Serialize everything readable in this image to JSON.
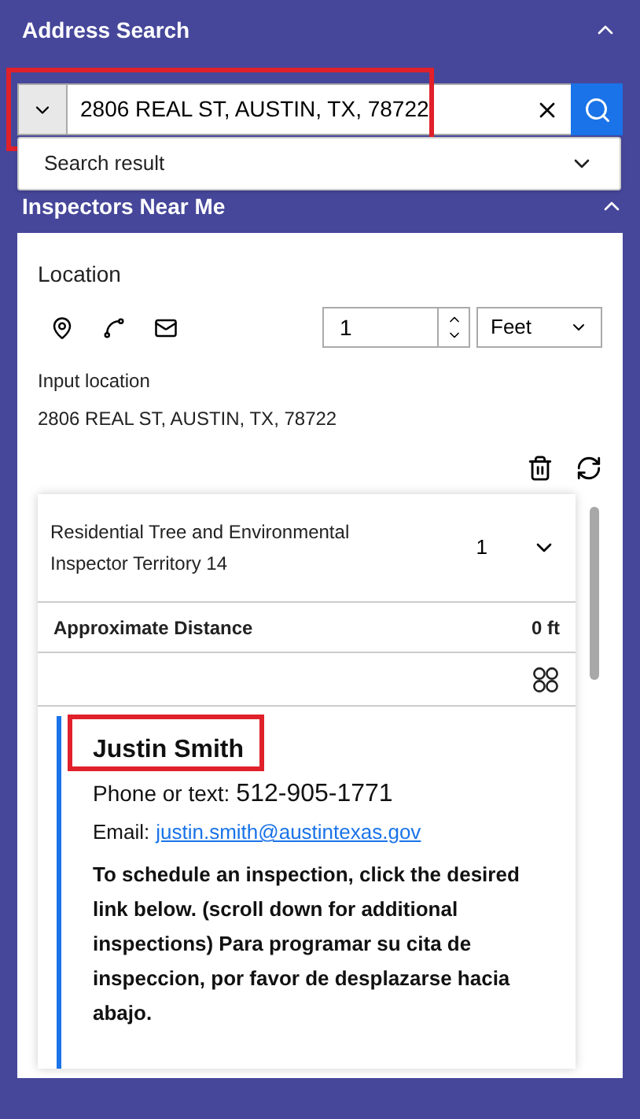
{
  "address_search": {
    "title": "Address Search",
    "expanded": true,
    "value": "2806 REAL ST, AUSTIN, TX, 78722",
    "dropdown": {
      "label": "Search result"
    }
  },
  "inspectors_panel": {
    "title": "Inspectors Near Me",
    "expanded": true,
    "location": {
      "label": "Location",
      "distance": "1",
      "unit": "Feet",
      "input_label": "Input location",
      "input_value": "2806 REAL ST, AUSTIN, TX, 78722"
    },
    "results": [
      {
        "title": "Residential Tree and Environmental Inspector Territory 14",
        "count": "1",
        "expanded": true,
        "distance_label": "Approximate Distance",
        "distance": "0 ft",
        "contact": {
          "name": "Justin Smith",
          "phone_label": "Phone or text:",
          "phone": "512-905-1771",
          "email_label": "Email:",
          "email": "justin.smith@austintexas.gov",
          "note": "To schedule an inspection, click the desired link below. (scroll down for additional inspections) Para programar su cita de inspeccion, por favor de desplazarse hacia abajo."
        }
      }
    ]
  }
}
